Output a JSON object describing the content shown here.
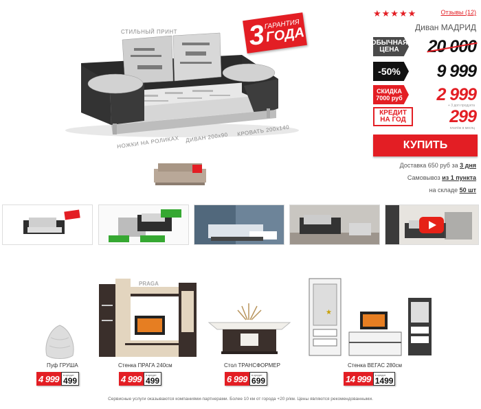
{
  "hero": {
    "label_print": "СТИЛЬНЫЙ ПРИНТ",
    "label_legs": "НОЖКИ НА РОЛИКАХ",
    "label_size": "ДИВАН 200х90",
    "label_bed": "КРОВАТЬ 200х140",
    "guarantee_num": "3",
    "guarantee_top": "ГАРАНТИЯ",
    "guarantee_bottom": "ГОДА"
  },
  "panel": {
    "stars": "★★★★★",
    "reviews": "Отзывы (12)",
    "title": "Диван МАДРИД",
    "regular_label": "ОБЫЧНАЯ ЦЕНА",
    "regular_price": "20 000",
    "discount_label": "-50%",
    "discount_price": "9 999",
    "extra_label": "СКИДКА 7000 руб",
    "extra_price": "2 999",
    "extra_note": "+ 3 доп продукта",
    "credit_label": "КРЕДИТ НА ГОД",
    "credit_price": "299",
    "credit_note": "платёж в месяц",
    "buy": "КУПИТЬ",
    "delivery_text": "Доставка 650 руб за ",
    "delivery_bold": "3 дня",
    "pickup_text": "Самовывоз ",
    "pickup_bold": "из 1 пункта",
    "stock_text": "на складе ",
    "stock_bold": "50 шт"
  },
  "recommendations": [
    {
      "name": "Пуф ГРУША",
      "price": "4 999",
      "credit_label": "в кредит",
      "credit": "499"
    },
    {
      "name": "Стенка ПРАГА 240см",
      "price": "4 999",
      "credit_label": "в кредит",
      "credit": "499"
    },
    {
      "name": "Стол ТРАНСФОРМЕР",
      "price": "6 999",
      "credit_label": "в кредит",
      "credit": "699"
    },
    {
      "name": "Стенка ВЕГАС 280см",
      "price": "14 999",
      "credit_label": "в кредит",
      "credit": "1499"
    }
  ],
  "footer": "Сервисные услуги оказываются компаниями-партнерами. Более 10 км от города +20 р/км. Цены являются рекомендованными.",
  "colors": {
    "accent": "#e31e24",
    "dark": "#111111",
    "grey": "#4a4a4a"
  }
}
